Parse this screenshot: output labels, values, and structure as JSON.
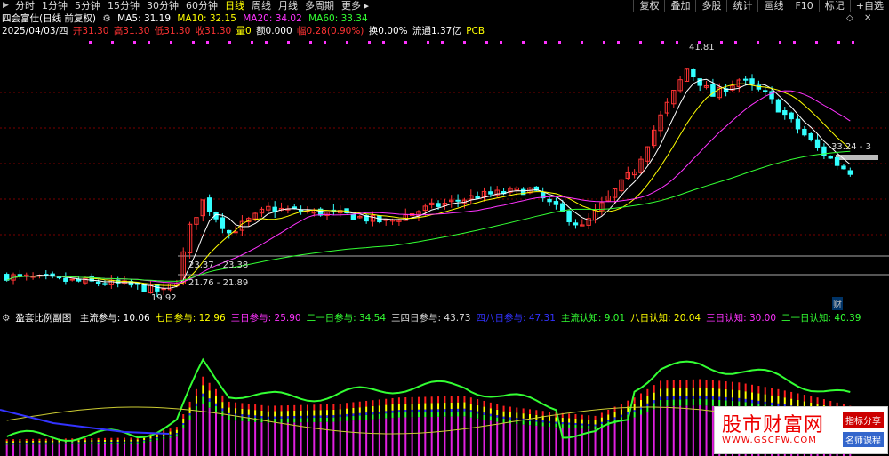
{
  "toolbar": {
    "periods": [
      "分时",
      "1分钟",
      "5分钟",
      "15分钟",
      "30分钟",
      "60分钟",
      "日线",
      "周线",
      "月线",
      "多周期",
      "更多"
    ],
    "active_period": "日线",
    "right_buttons": [
      "复权",
      "叠加",
      "多股",
      "统计",
      "画线",
      "F10",
      "标记",
      "+自选"
    ]
  },
  "header": {
    "title": "四会富仕(日线 前复权)",
    "ma5": "MA5: 31.19",
    "ma10": "MA10: 32.15",
    "ma20": "MA20: 34.02",
    "ma60": "MA60: 33.34",
    "date": "2025/04/03/四",
    "open": "开31.30",
    "high": "高31.30",
    "low": "低31.30",
    "close": "收31.30",
    "volume": "量0",
    "amount": "额0.000",
    "change": "幅0.28(0.90%)",
    "turnover": "换0.00%",
    "float_cap": "流通1.37亿",
    "sector": "PCB"
  },
  "main_chart": {
    "annotations": [
      "41.81",
      "33.24 - 3",
      "23.37 - 23.38",
      "21.76 - 21.89",
      "19.92"
    ],
    "label_cai": "财"
  },
  "indicator": {
    "name": "盈套比例副图",
    "items": [
      {
        "label": "主流参与: 10.06",
        "color": "#ffffff"
      },
      {
        "label": "七日参与: 12.96",
        "color": "#ffff00"
      },
      {
        "label": "三日参与: 25.90",
        "color": "#ff33ff"
      },
      {
        "label": "二一日参与: 34.54",
        "color": "#33ff33"
      },
      {
        "label": "三四日参与: 43.73",
        "color": "#dddddd"
      },
      {
        "label": "四八日参与: 47.31",
        "color": "#3333ff"
      },
      {
        "label": "主流认知: 9.01",
        "color": "#33ff33"
      },
      {
        "label": "八日认知: 20.04",
        "color": "#ffff00"
      },
      {
        "label": "三日认知: 30.00",
        "color": "#ff33ff"
      },
      {
        "label": "二一日认知: 40.39",
        "color": "#33ff33"
      }
    ]
  },
  "watermark": {
    "title": "股市财富网",
    "url": "WWW.GSCFW.COM",
    "tag1": "指标分享",
    "tag2": "名师课程"
  },
  "colors": {
    "up": "#ff3333",
    "down": "#33ffff",
    "ma5": "#ffffff",
    "ma10": "#ffff00",
    "ma20": "#ff33ff",
    "ma60": "#33ff33"
  }
}
